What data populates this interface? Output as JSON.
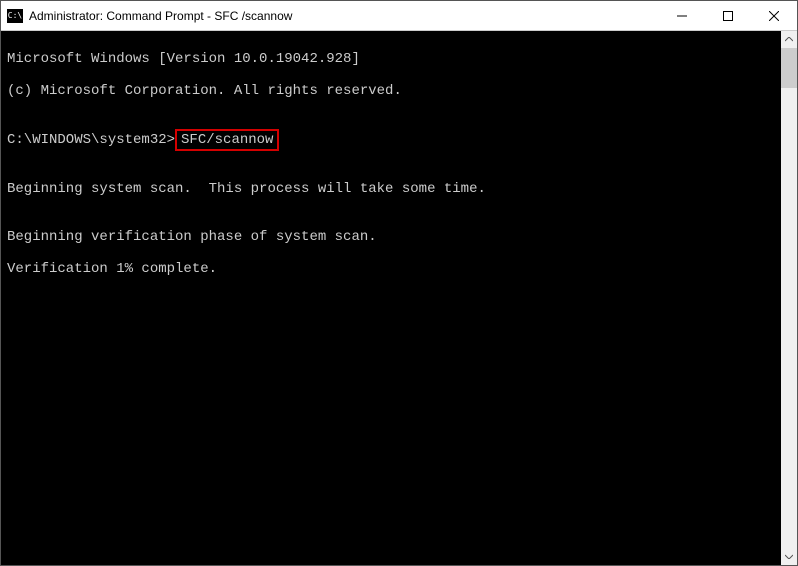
{
  "titlebar": {
    "icon_label": "C:\\",
    "title": "Administrator: Command Prompt - SFC /scannow"
  },
  "console": {
    "line1": "Microsoft Windows [Version 10.0.19042.928]",
    "line2": "(c) Microsoft Corporation. All rights reserved.",
    "blank1": "",
    "prompt_prefix": "C:\\WINDOWS\\system32>",
    "prompt_command": "SFC/scannow",
    "blank2": "",
    "line4": "Beginning system scan.  This process will take some time.",
    "blank3": "",
    "line5": "Beginning verification phase of system scan.",
    "line6": "Verification 1% complete."
  }
}
